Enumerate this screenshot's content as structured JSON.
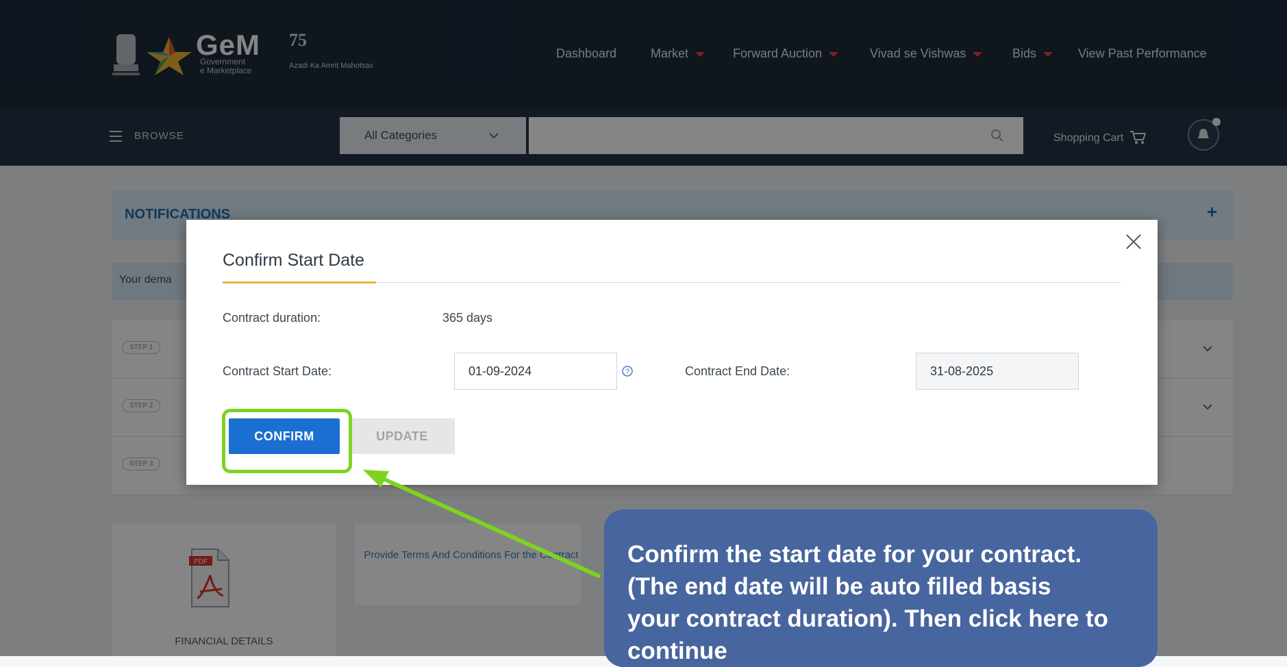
{
  "header": {
    "brand": "GeM",
    "brand_sub_line1": "Government",
    "brand_sub_line2": "e Marketplace",
    "azadi_logo": "75",
    "azadi_sub": "Azadi Ka Amrit Mahotsav",
    "nav": [
      {
        "label": "Dashboard",
        "has_caret": false
      },
      {
        "label": "Market",
        "has_caret": true
      },
      {
        "label": "Forward Auction",
        "has_caret": true
      },
      {
        "label": "Vivad se Vishwas",
        "has_caret": true
      },
      {
        "label": "Bids",
        "has_caret": true
      },
      {
        "label": "View Past Performance",
        "has_caret": false
      }
    ]
  },
  "searchbar": {
    "browse_label": "BROWSE",
    "category_selected": "All Categories",
    "search_value": "",
    "cart_label": "Shopping Cart"
  },
  "page": {
    "notifications_title": "NOTIFICATIONS",
    "notifications_toggle": "+",
    "demand_text": "Your dema",
    "steps": [
      "STEP 1",
      "STEP 2",
      "STEP 3"
    ],
    "financial_details_label": "FINANCIAL DETAILS",
    "pdf_badge": "PDF",
    "terms_link": "Provide Terms And Conditions For the Contract"
  },
  "modal": {
    "title": "Confirm Start Date",
    "close_icon": "close-icon",
    "contract_duration_label": "Contract duration:",
    "contract_duration_value": "365 days",
    "start_date_label": "Contract Start Date:",
    "start_date_value": "01-09-2024",
    "end_date_label": "Contract End Date:",
    "end_date_value": "31-08-2025",
    "confirm_button": "CONFIRM",
    "update_button": "UPDATE"
  },
  "annotation": {
    "tooltip_line1": "Confirm the start date for your contract.",
    "tooltip_line2": "(The end date will be auto filled basis",
    "tooltip_line3": "your contract duration). Then click here to",
    "tooltip_line4": "continue",
    "highlight_color": "#7ed321",
    "tooltip_color": "#47659e"
  },
  "colors": {
    "header_bg": "#1d2b3b",
    "primary_button": "#1b6fd1",
    "title_accent": "#e8b13c"
  }
}
